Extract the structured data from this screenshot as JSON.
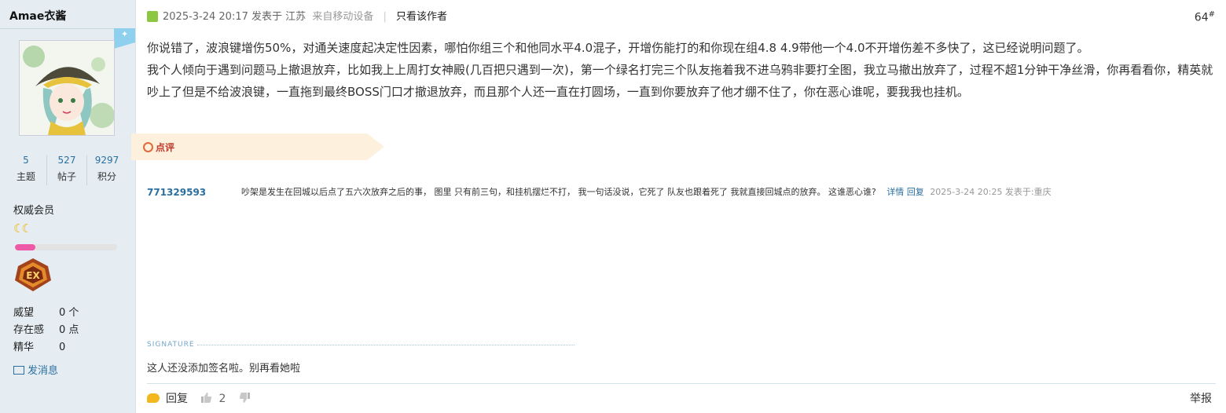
{
  "author": {
    "name": "Amae衣酱",
    "stats": [
      {
        "value": "5",
        "label": "主题"
      },
      {
        "value": "527",
        "label": "帖子"
      },
      {
        "value": "9297",
        "label": "积分"
      }
    ],
    "group": "权威会员",
    "level_progress": 0.2,
    "attributes": [
      {
        "key": "威望",
        "value": "0 个"
      },
      {
        "key": "存在感",
        "value": "0 点"
      },
      {
        "key": "精华",
        "value": "0"
      }
    ],
    "message_label": "发消息"
  },
  "post": {
    "date": "2025-3-24 20:17",
    "posted_in": "发表于",
    "location": "江苏",
    "device": "来自移动设备",
    "only_author": "只看该作者",
    "floor": "64",
    "floor_mark": "#",
    "paragraphs": [
      "你说错了，波浪键增伤50%，对通关速度起决定性因素，哪怕你组三个和他同水平4.0混子，开增伤能打的和你现在组4.8 4.9带他一个4.0不开增伤差不多快了，这已经说明问题了。",
      "我个人倾向于遇到问题马上撤退放弃，比如我上上周打女神殿(几百把只遇到一次)，第一个绿名打完三个队友拖着我不进乌鸦非要打全图，我立马撤出放弃了，过程不超1分钟干净丝滑，你再看看你，精英就吵上了但是不给波浪键，一直拖到最终BOSS门口才撤退放弃，而且那个人还一直在打圆场，一直到你要放弃了他才绷不住了，你在恶心谁呢，要我我也挂机。"
    ]
  },
  "comments": {
    "tab_label": "点评",
    "items": [
      {
        "user": "771329593",
        "text": "吵架是发生在回城以后点了五六次放弃之后的事， 图里 只有前三句，和挂机摆烂不打， 我一句话没说，它死了 队友也跟着死了 我就直接回城点的放弃。 这谁恶心谁?",
        "detail": "详情",
        "reply": "回复",
        "meta": "2025-3-24 20:25 发表于:重庆"
      }
    ]
  },
  "signature": {
    "label": "SIGNATURE",
    "text": "这人还没添加签名啦。别再看她啦"
  },
  "footer": {
    "reply": "回复",
    "likes": "2",
    "report": "举报"
  },
  "colors": {
    "sidebar_bg": "#e5edf2",
    "link_blue": "#2a6f9f",
    "comment_tab_bg": "#fdf1dd",
    "comment_label": "#c0392b",
    "progress_pink": "#ee5aa8"
  }
}
